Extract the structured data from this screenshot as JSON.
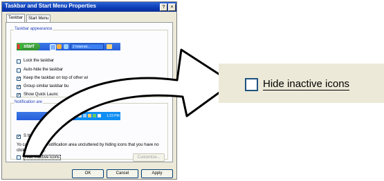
{
  "dialog": {
    "title": "Taskbar and Start Menu Properties",
    "help_btn": "?",
    "close_btn": "×",
    "tabs": [
      {
        "label": "Taskbar"
      },
      {
        "label": "Start Menu"
      }
    ],
    "taskbar_appearance": {
      "group_title": "Taskbar appearance",
      "preview": {
        "start_label": "start",
        "task_label": "2 Internet..."
      },
      "options": [
        {
          "label": "Lock the taskbar",
          "checked": false
        },
        {
          "label": "Auto-hide the taskbar",
          "checked": false
        },
        {
          "label": "Keep the taskbar on top of other wi",
          "checked": true
        },
        {
          "label": "Group similar taskbar bu",
          "checked": true
        },
        {
          "label": "Show Quick Launc",
          "checked": true
        }
      ]
    },
    "notification_area": {
      "group_title": "Notification are",
      "clock_time": "1:23 PM",
      "show_clock_label": "S   the clock",
      "description": "Yo   can keep the notification area uncluttered by hiding icons that you have no   clicked recently.",
      "hide_inactive_label": "Hide inactive icons",
      "customize_label": "Customize..."
    },
    "buttons": {
      "ok": "OK",
      "cancel": "Cancel",
      "apply": "Apply"
    }
  },
  "zoom": {
    "label": "Hide inactive icons"
  },
  "colors": {
    "dialog_bg": "#ECE9D8",
    "title_blue": "#0b3bb5",
    "group_title": "#1f3fba"
  }
}
